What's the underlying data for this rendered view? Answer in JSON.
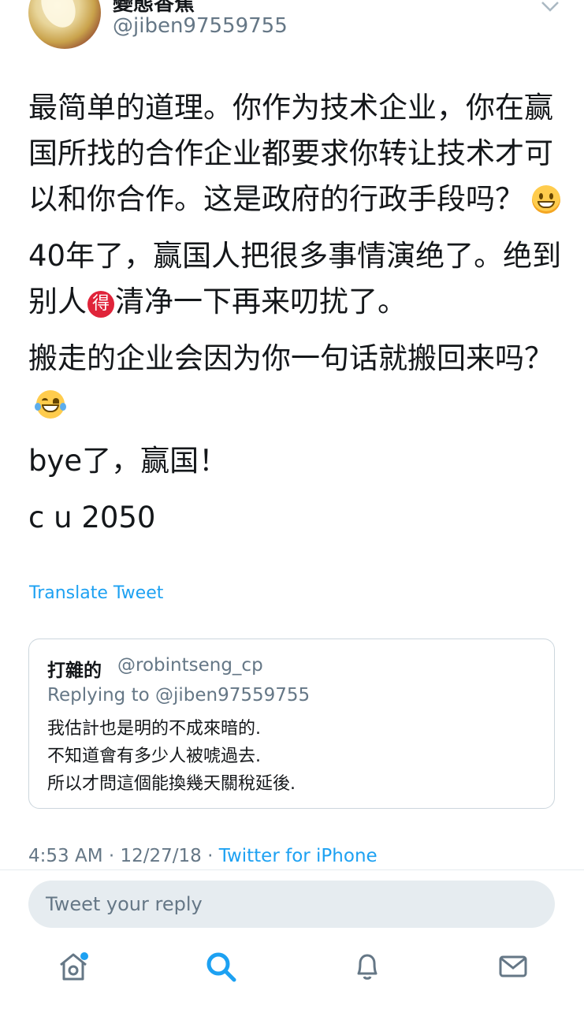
{
  "tweet": {
    "author": {
      "display_name": "變態香蕉",
      "handle": "@jiben97559755"
    },
    "paragraphs": {
      "p1": "最简单的道理。你作为技术企业，你在赢国所找的合作企业都要求你转让技术才可以和你合作。这是政府的行政手段吗？",
      "p2_a": "40年了，赢国人把很多事情演绝了。绝到别人",
      "p2_badge": "得",
      "p2_b": "清净一下再来叨扰了。",
      "p3": "搬走的企业会因为你一句话就搬回来吗？",
      "p4": "bye了，赢国！",
      "p5": "c u 2050"
    },
    "emoji": [
      "grinning-face",
      "face-with-tears-of-joy"
    ],
    "translate_label": "Translate Tweet",
    "timestamp": "4:53 AM · 12/27/18 · ",
    "source": "Twitter for iPhone"
  },
  "quoted": {
    "name": "打雜的",
    "handle": "@robintseng_cp",
    "replying_to": "Replying to @jiben97559755",
    "lines": [
      "我估計也是明的不成來暗的.",
      "不知道會有多少人被唬過去.",
      "所以才問這個能換幾天關稅延後."
    ]
  },
  "reply": {
    "placeholder": "Tweet your reply"
  },
  "tabs": [
    "home-icon",
    "search-icon",
    "notifications-icon",
    "messages-icon"
  ],
  "colors": {
    "accent": "#1da1f2",
    "muted": "#657786",
    "text": "#14171a",
    "border": "#ccd6dd"
  }
}
